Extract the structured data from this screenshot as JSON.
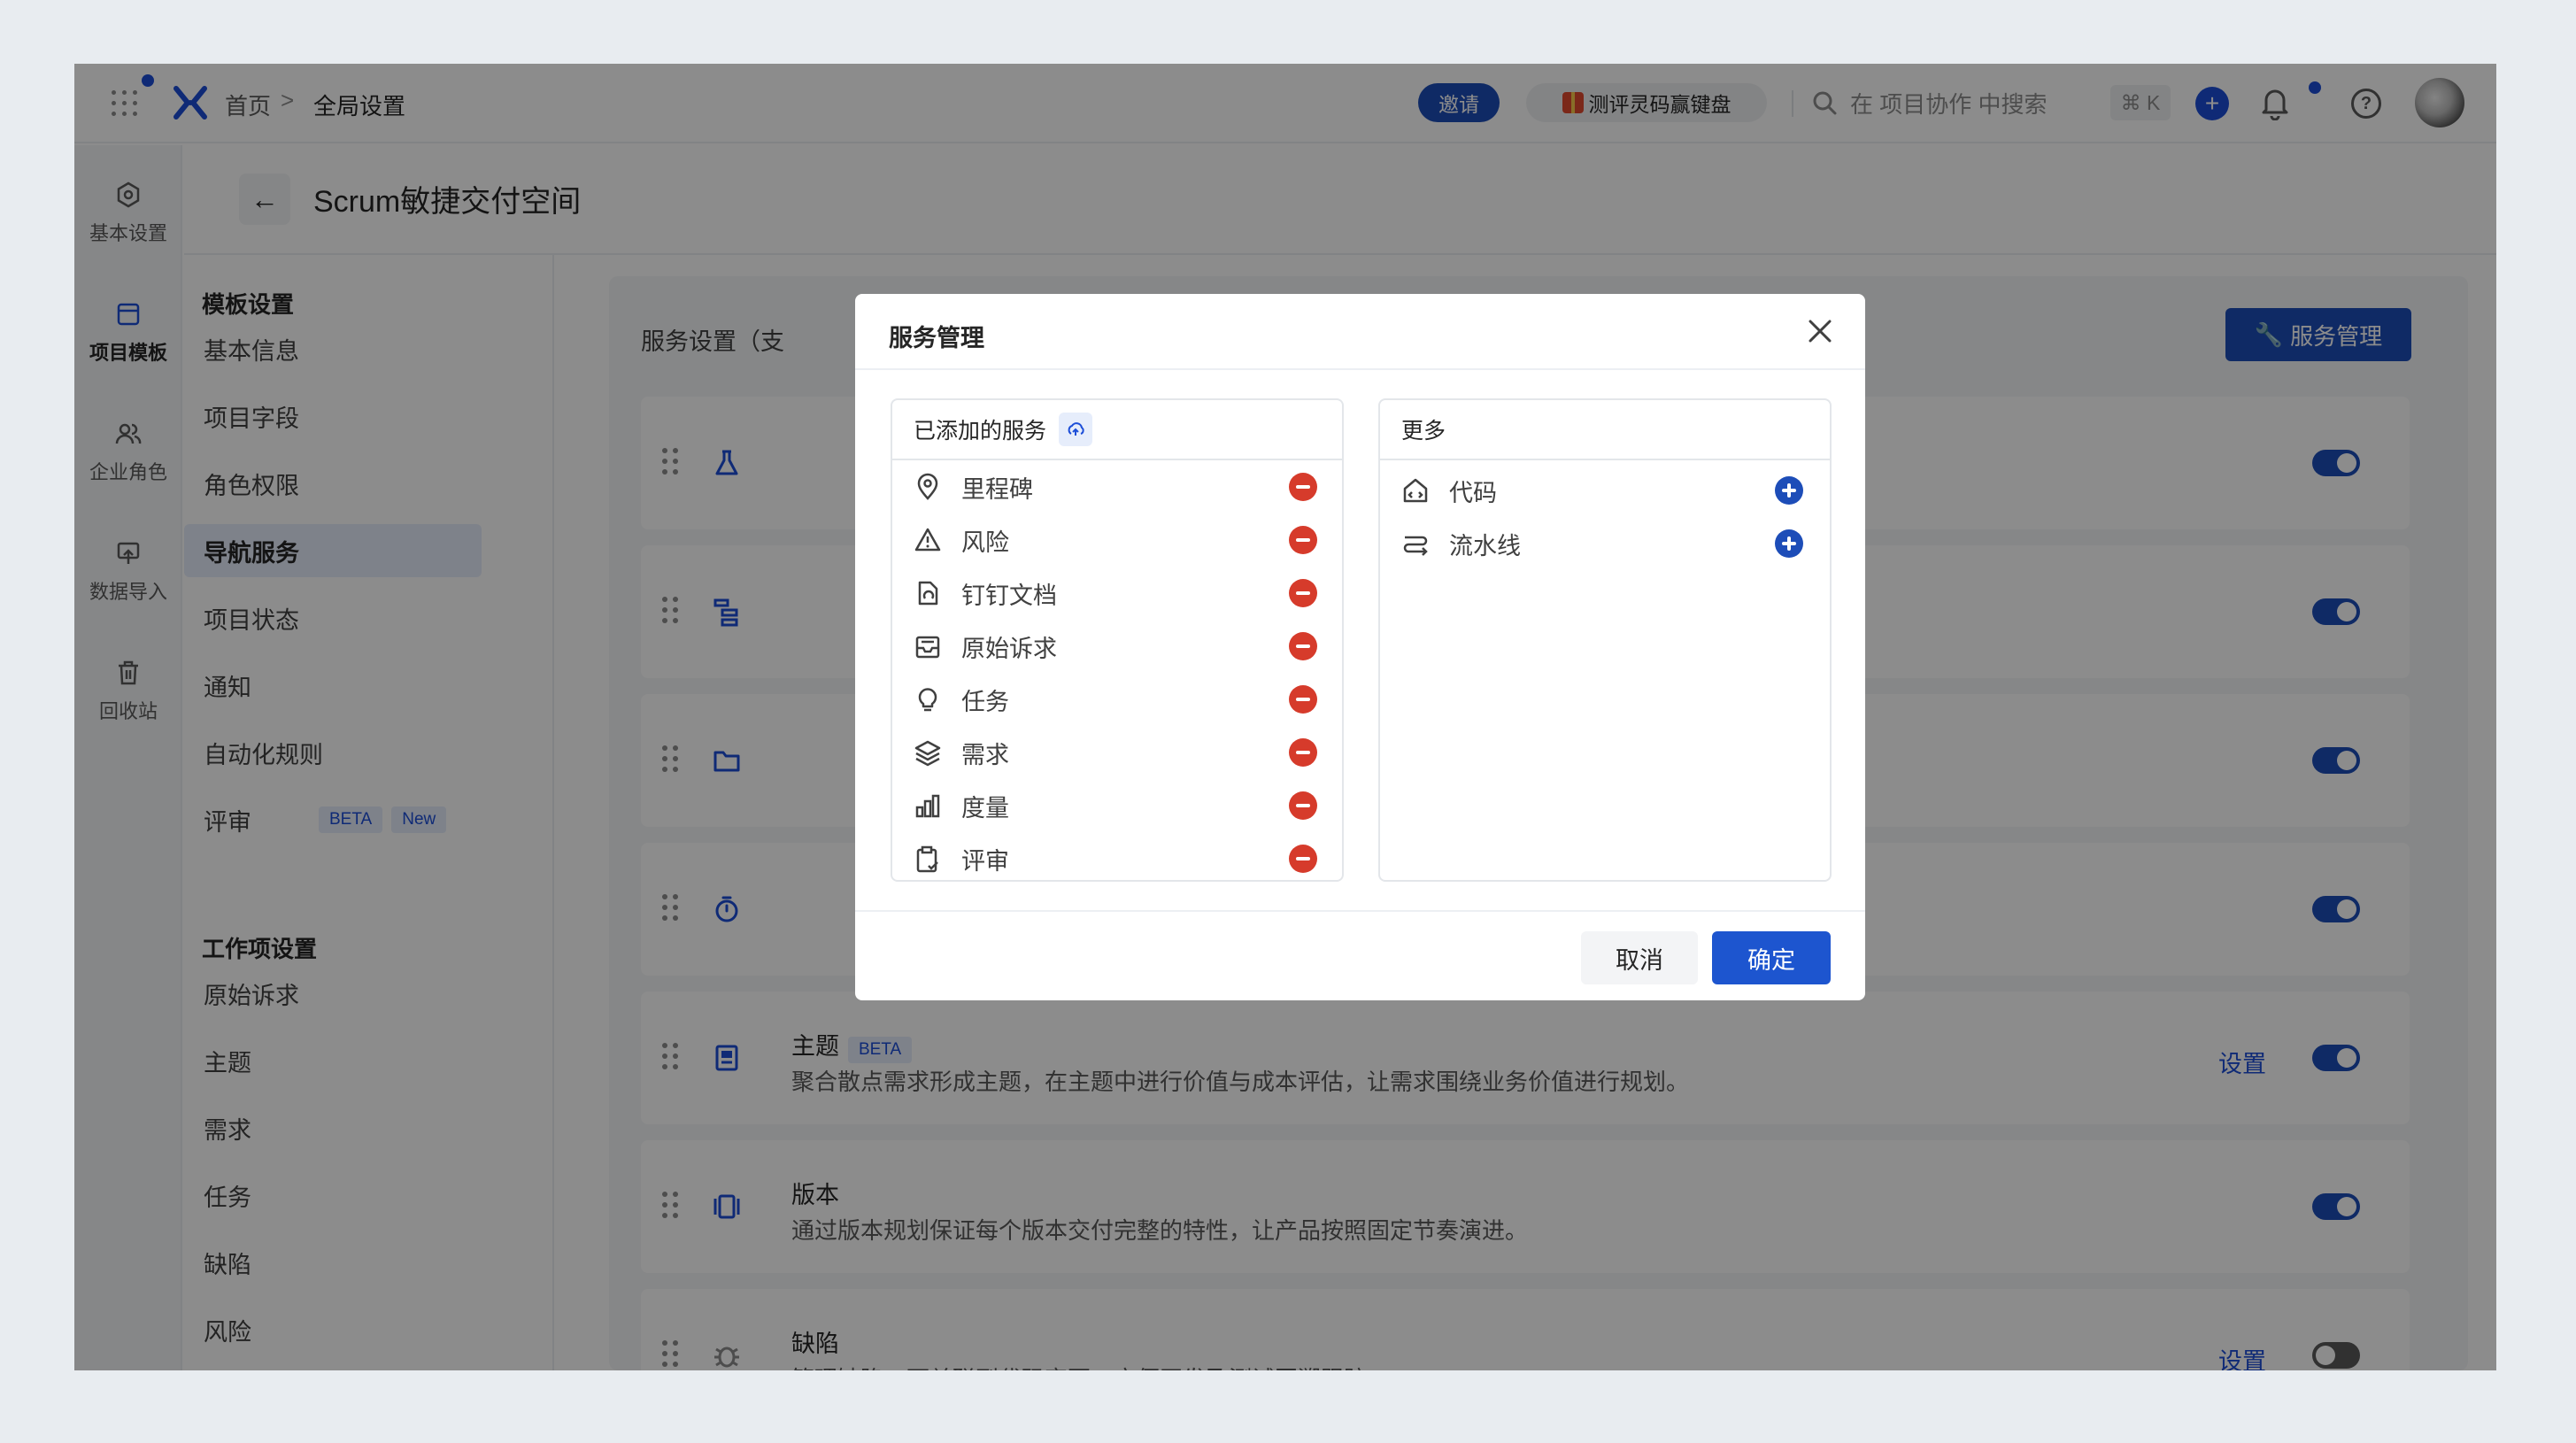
{
  "breadcrumb": {
    "home": "首页",
    "separator": ">",
    "current": "全局设置"
  },
  "topbar": {
    "invite": "邀请",
    "promo": "测评灵码赢键盘",
    "search_placeholder": "在 项目协作 中搜索",
    "shortcut": "⌘ K",
    "plus": "+",
    "help": "?"
  },
  "rail": [
    {
      "label": "基本设置",
      "icon": "hexagon-gear-icon"
    },
    {
      "label": "项目模板",
      "icon": "template-icon"
    },
    {
      "label": "企业角色",
      "icon": "users-icon"
    },
    {
      "label": "数据导入",
      "icon": "import-icon"
    },
    {
      "label": "回收站",
      "icon": "trash-icon"
    }
  ],
  "page": {
    "title": "Scrum敏捷交付空间"
  },
  "nav": {
    "group1": "模板设置",
    "items1": [
      "基本信息",
      "项目字段",
      "角色权限",
      "导航服务",
      "项目状态",
      "通知",
      "自动化规则",
      "评审"
    ],
    "badge_beta": "BETA",
    "badge_new": "New",
    "group2": "工作项设置",
    "items2": [
      "原始诉求",
      "主题",
      "需求",
      "任务",
      "缺陷",
      "风险"
    ]
  },
  "content": {
    "label": "服务设置（支",
    "service_button": "服务管理",
    "settings_link": "设置",
    "cards": [
      {
        "title": "主题",
        "badge": "BETA",
        "desc": "聚合散点需求形成主题，在主题中进行价值与成本评估，让需求围绕业务价值进行规划。"
      },
      {
        "title": "版本",
        "desc": "通过版本规划保证每个版本交付完整的特性，让产品按照固定节奏演进。"
      },
      {
        "title": "缺陷",
        "desc": "管理缺陷，可关联到代码变更，方便开发及测试回溯跟踪"
      }
    ]
  },
  "modal": {
    "title": "服务管理",
    "added_title": "已添加的服务",
    "more_title": "更多",
    "added": [
      {
        "label": "里程碑",
        "icon": "location-pin-icon"
      },
      {
        "label": "风险",
        "icon": "warning-triangle-icon"
      },
      {
        "label": "钉钉文档",
        "icon": "document-icon"
      },
      {
        "label": "原始诉求",
        "icon": "inbox-icon"
      },
      {
        "label": "任务",
        "icon": "lightbulb-icon"
      },
      {
        "label": "需求",
        "icon": "layers-icon"
      },
      {
        "label": "度量",
        "icon": "bar-chart-icon"
      },
      {
        "label": "评审",
        "icon": "clipboard-check-icon"
      }
    ],
    "more": [
      {
        "label": "代码",
        "icon": "code-icon"
      },
      {
        "label": "流水线",
        "icon": "pipeline-icon"
      }
    ],
    "cancel": "取消",
    "ok": "确定"
  }
}
